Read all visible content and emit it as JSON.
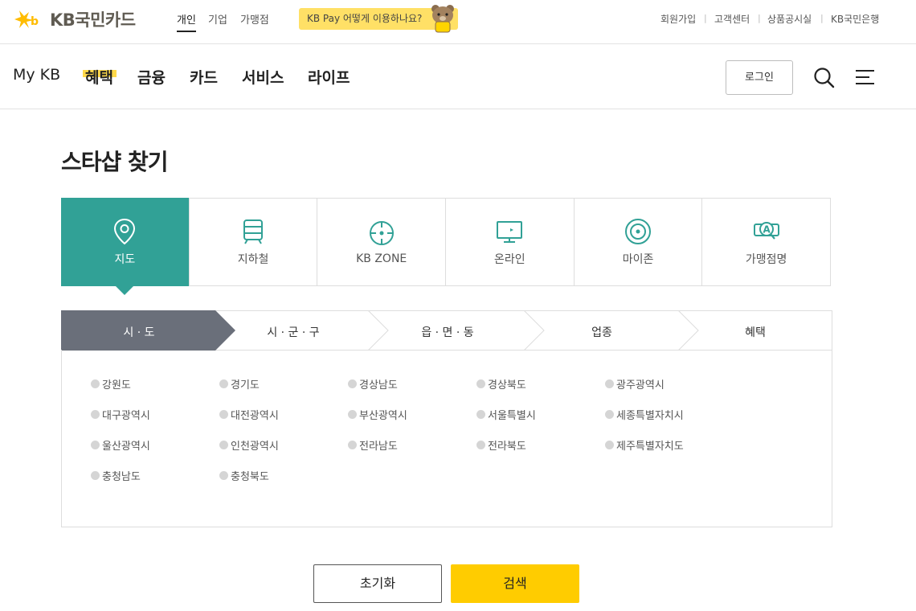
{
  "header": {
    "logo_text": "KB국민카드",
    "segments": [
      "개인",
      "기업",
      "가맹점"
    ],
    "pay_banner": "KB Pay 어떻게 이용하나요?",
    "util_links": [
      "회원가입",
      "고객센터",
      "상품공시실",
      "KB국민은행"
    ]
  },
  "gnb": {
    "items": [
      "My KB",
      "혜택",
      "금융",
      "카드",
      "서비스",
      "라이프"
    ],
    "login_label": "로그인"
  },
  "page": {
    "title": "스타샵 찾기"
  },
  "tabs": [
    {
      "label": "지도",
      "icon": "map-pin-icon",
      "active": true
    },
    {
      "label": "지하철",
      "icon": "subway-icon",
      "active": false
    },
    {
      "label": "KB ZONE",
      "icon": "target-icon",
      "active": false
    },
    {
      "label": "온라인",
      "icon": "monitor-icon",
      "active": false
    },
    {
      "label": "마이존",
      "icon": "myzone-icon",
      "active": false
    },
    {
      "label": "가맹점명",
      "icon": "store-search-icon",
      "active": false
    }
  ],
  "steps": [
    "시 · 도",
    "시 · 군 · 구",
    "읍 · 면 · 동",
    "업종",
    "혜택"
  ],
  "regions": [
    "강원도",
    "경기도",
    "경상남도",
    "경상북도",
    "광주광역시",
    "대구광역시",
    "대전광역시",
    "부산광역시",
    "서울특별시",
    "세종특별자치시",
    "울산광역시",
    "인천광역시",
    "전라남도",
    "전라북도",
    "제주특별자치도",
    "충청남도",
    "충청북도"
  ],
  "buttons": {
    "reset": "초기화",
    "search": "검색"
  },
  "colors": {
    "accent": "#31a196",
    "step_active": "#6a6f7a",
    "brand_yellow": "#ffcc00",
    "highlight": "#ffd94a"
  }
}
